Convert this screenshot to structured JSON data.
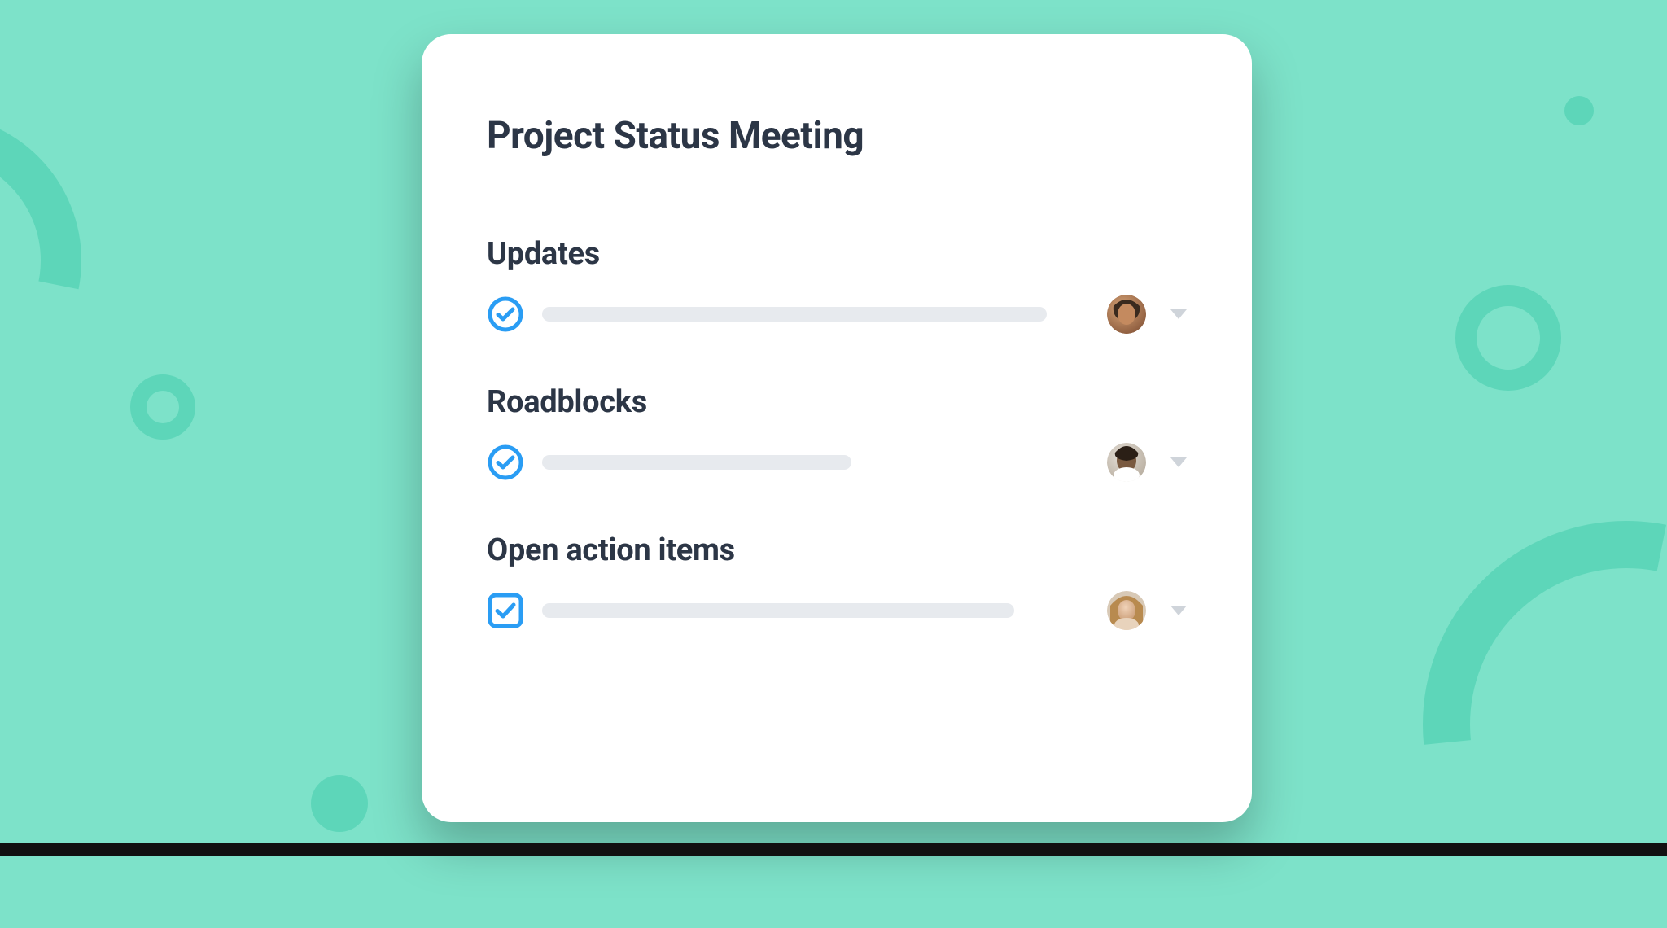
{
  "card": {
    "title": "Project Status Meeting"
  },
  "sections": [
    {
      "title": "Updates",
      "checked": true,
      "check_shape": "circle",
      "bar_width": "bar-w-620"
    },
    {
      "title": "Roadblocks",
      "checked": true,
      "check_shape": "circle",
      "bar_width": "bar-w-380"
    },
    {
      "title": "Open action items",
      "checked": true,
      "check_shape": "square",
      "bar_width": "bar-w-580"
    }
  ],
  "colors": {
    "background": "#7de2c9",
    "accent_shapes": "#5dd6b9",
    "card_bg": "#ffffff",
    "text": "#2c3646",
    "placeholder": "#e7eaee",
    "check_blue": "#2a9df4",
    "caret": "#cfd4da"
  }
}
